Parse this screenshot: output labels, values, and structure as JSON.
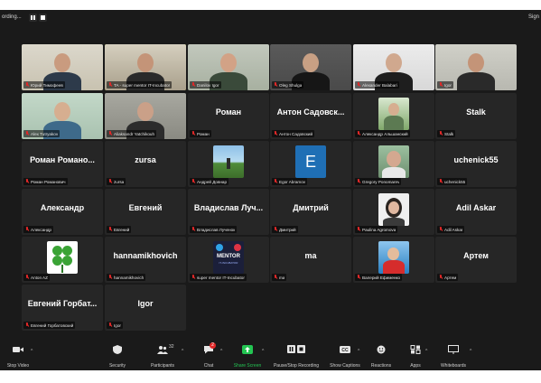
{
  "topbar": {
    "recording_text": "ording...",
    "right_text": "Sign"
  },
  "tiles": [
    {
      "name": "Юрий Тимофеев",
      "kind": "video",
      "bg": "#c8c2b0",
      "wall": "#dcd8cc",
      "skin": "#c99b7f",
      "shirt": "#2d3a4a"
    },
    {
      "name": "TA - super mentor IT-Incubator",
      "kind": "video",
      "bg": "#a9a08c",
      "wall": "#d5cfbf",
      "skin": "#c49478",
      "shirt": "#2a2a2a",
      "active": true
    },
    {
      "name": "Danilov Igor",
      "kind": "video",
      "bg": "#a7b0a0",
      "wall": "#c2c8bd",
      "skin": "#d2a286",
      "shirt": "#3a4a3a"
    },
    {
      "name": "Oleg Shulga",
      "kind": "video",
      "bg": "#4a4a4a",
      "wall": "#5a5a5a",
      "skin": "#c8a084",
      "shirt": "#161616"
    },
    {
      "name": "Alexander Balabari",
      "kind": "video",
      "bg": "#d8d8d8",
      "wall": "#ececec",
      "skin": "#d0a88e",
      "shirt": "#1e1e1e"
    },
    {
      "name": "Igor",
      "kind": "video",
      "bg": "#b8b8b0",
      "wall": "#d0d0c8",
      "skin": "#c49478",
      "shirt": "#2a2a2a"
    },
    {
      "name": "Alex Tutryakov",
      "kind": "video",
      "bg": "#a9c2b0",
      "wall": "#c3d8c8",
      "skin": "#d6ae90",
      "shirt": "#3e6a8a"
    },
    {
      "name": "Aliaksandr Yatchikouh",
      "kind": "video",
      "bg": "#8a8a82",
      "wall": "#a8a8a0",
      "skin": "#caa088",
      "shirt": "#2c2c2c"
    },
    {
      "name": "Роман",
      "kind": "name",
      "big": "Роман"
    },
    {
      "name": "Антон Садовский",
      "kind": "name",
      "big": "Антон Садовск..."
    },
    {
      "name": "Александр Альшанский",
      "kind": "photo",
      "photo": "person-green"
    },
    {
      "name": "Stalk",
      "kind": "name",
      "big": "Stalk"
    },
    {
      "name": "Роман Романович",
      "kind": "name",
      "big": "Роман Романо..."
    },
    {
      "name": "zursa",
      "kind": "name",
      "big": "zursa"
    },
    {
      "name": "Андрей Довнар",
      "kind": "photo",
      "photo": "landscape"
    },
    {
      "name": "Egor Abramov",
      "kind": "letter",
      "letter": "E"
    },
    {
      "name": "Gregory Ponomarev",
      "kind": "photo",
      "photo": "person-outdoor"
    },
    {
      "name": "uchenick55",
      "kind": "name",
      "big": "uchenick55"
    },
    {
      "name": "Александр",
      "kind": "name",
      "big": "Александр"
    },
    {
      "name": "Евгений",
      "kind": "name",
      "big": "Евгений"
    },
    {
      "name": "Владислав Лученок",
      "kind": "name",
      "big": "Владислав Луч..."
    },
    {
      "name": "Дмитрий",
      "kind": "name",
      "big": "Дмитрий"
    },
    {
      "name": "Paulina Agromova",
      "kind": "photo",
      "photo": "woman"
    },
    {
      "name": "Adil Askar",
      "kind": "name",
      "big": "Adil Askar"
    },
    {
      "name": "Anton AZ",
      "kind": "photo",
      "photo": "clover"
    },
    {
      "name": "hannamikhovich",
      "kind": "name",
      "big": "hannamikhovich"
    },
    {
      "name": "super mentor IT-Incubator",
      "kind": "photo",
      "photo": "mentor",
      "mentor_title": "MENTOR",
      "mentor_sub": "IT-INCUBATOR"
    },
    {
      "name": "ma",
      "kind": "name",
      "big": "ma"
    },
    {
      "name": "Валерий Ефименко",
      "kind": "photo",
      "photo": "cyclist"
    },
    {
      "name": "Артем",
      "kind": "name",
      "big": "Артем"
    },
    {
      "name": "Евгений Горбатовский",
      "kind": "name",
      "big": "Евгений Горбат..."
    },
    {
      "name": "Igor",
      "kind": "name",
      "big": "Igor"
    }
  ],
  "toolbar": {
    "stop_video": "Stop Video",
    "security": "Security",
    "participants": "Participants",
    "participants_count": "32",
    "chat": "Chat",
    "chat_badge": "2",
    "share_screen": "Share Screen",
    "pause_stop_recording": "Pause/Stop Recording",
    "show_captions": "Show Captions",
    "reactions": "Reactions",
    "apps": "Apps",
    "whiteboards": "Whiteboards"
  },
  "colors": {
    "share_green": "#23c552",
    "mic_muted": "#e02828",
    "active_border": "#c4d600",
    "egor_blue": "#1f6fb5"
  }
}
